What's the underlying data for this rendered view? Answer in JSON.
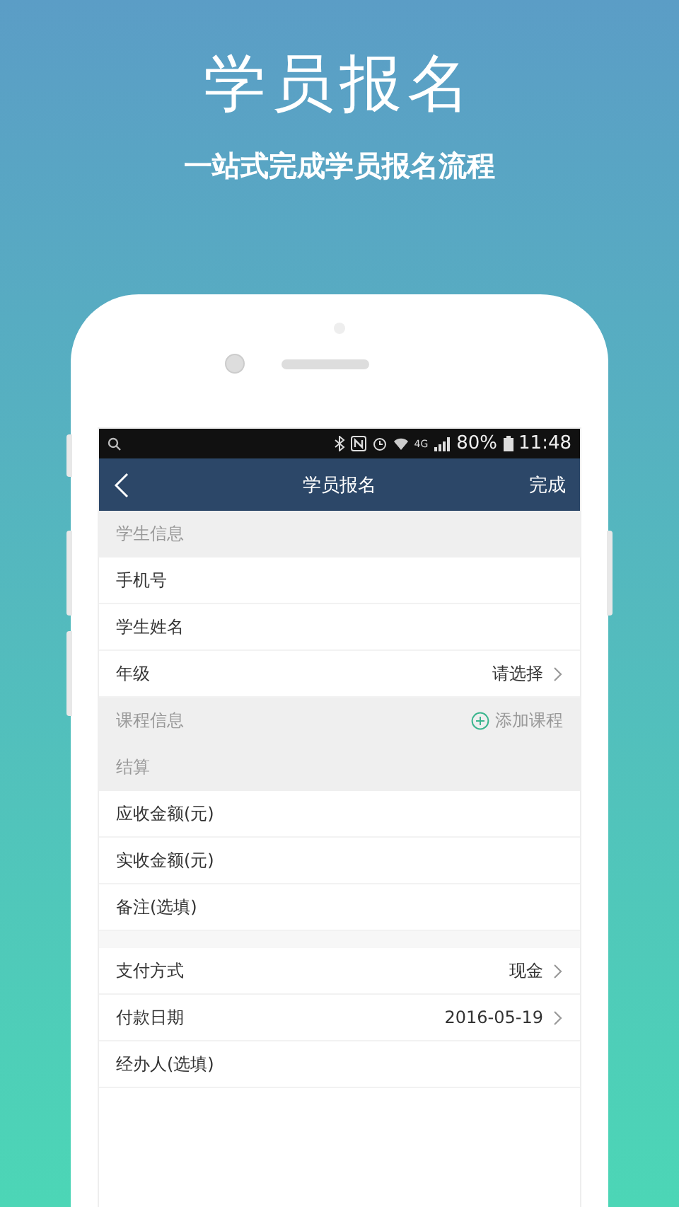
{
  "promo": {
    "title": "学员报名",
    "subtitle": "一站式完成学员报名流程"
  },
  "status_bar": {
    "network": "4G",
    "battery": "80%",
    "time": "11:48"
  },
  "nav": {
    "title": "学员报名",
    "action": "完成"
  },
  "rows": [
    {
      "kind": "header",
      "label": "学生信息"
    },
    {
      "kind": "field",
      "label": "手机号"
    },
    {
      "kind": "field",
      "label": "学生姓名"
    },
    {
      "kind": "select",
      "label": "年级",
      "value": "请选择"
    },
    {
      "kind": "header",
      "label": "课程信息",
      "action": "添加课程"
    },
    {
      "kind": "header",
      "label": "结算"
    },
    {
      "kind": "field",
      "label": "应收金额(元)"
    },
    {
      "kind": "field",
      "label": "实收金额(元)"
    },
    {
      "kind": "field",
      "label": "备注(选填)"
    },
    {
      "kind": "spacer"
    },
    {
      "kind": "select",
      "label": "支付方式",
      "value": "现金"
    },
    {
      "kind": "select",
      "label": "付款日期",
      "value": "2016-05-19"
    },
    {
      "kind": "field",
      "label": "经办人(选填)"
    }
  ]
}
